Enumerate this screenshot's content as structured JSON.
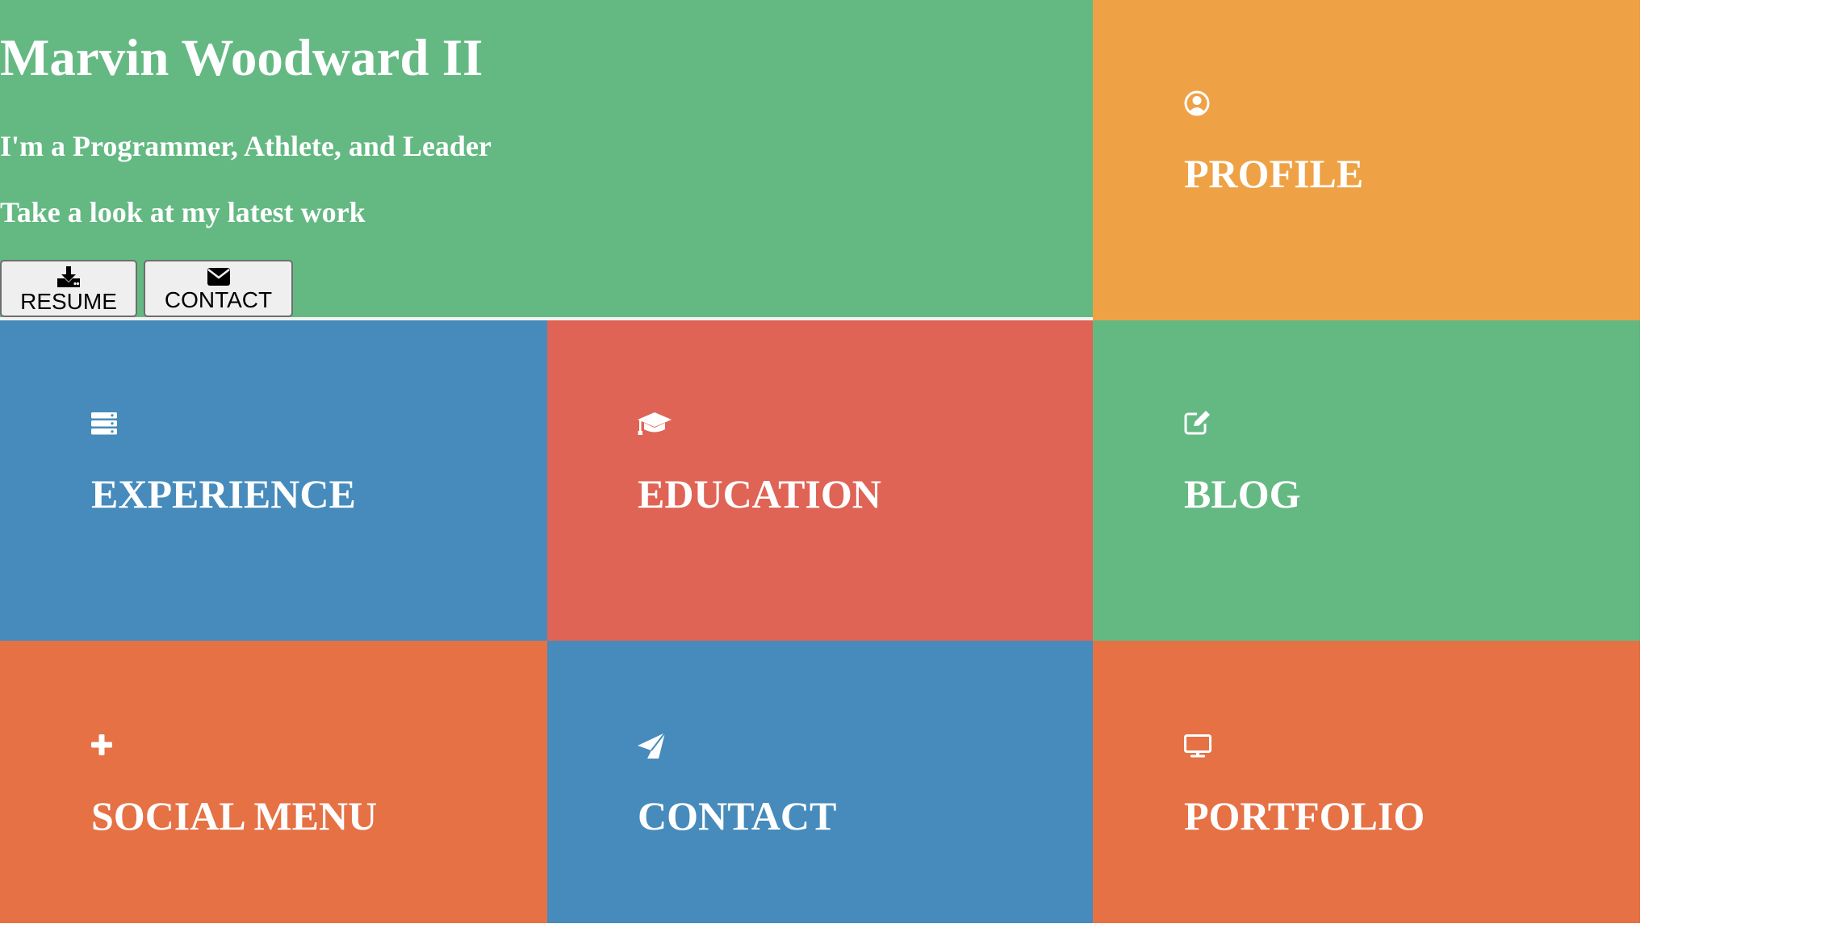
{
  "colors": {
    "green": "#64b983",
    "orange": "#eea245",
    "blue": "#468bbb",
    "red": "#df6456",
    "deep_orange": "#e57145"
  },
  "hero": {
    "name": "Marvin Woodward II",
    "tagline": "I'm a Programmer, Athlete, and Leader",
    "cta": "Take a look at my latest work",
    "buttons": [
      {
        "label": "RESUME",
        "icon": "download-icon"
      },
      {
        "label": "CONTACT",
        "icon": "envelope-icon"
      }
    ]
  },
  "tiles": [
    {
      "label": "PROFILE",
      "icon": "user-circle-icon",
      "color": "#eea245"
    },
    {
      "label": "EXPERIENCE",
      "icon": "server-icon",
      "color": "#468bbb"
    },
    {
      "label": "EDUCATION",
      "icon": "graduation-cap-icon",
      "color": "#df6456"
    },
    {
      "label": "BLOG",
      "icon": "edit-icon",
      "color": "#64b983"
    },
    {
      "label": "SOCIAL MENU",
      "icon": "plus-icon",
      "color": "#e57145"
    },
    {
      "label": "CONTACT",
      "icon": "paper-plane-icon",
      "color": "#468bbb"
    },
    {
      "label": "PORTFOLIO",
      "icon": "desktop-icon",
      "color": "#e57145"
    }
  ]
}
